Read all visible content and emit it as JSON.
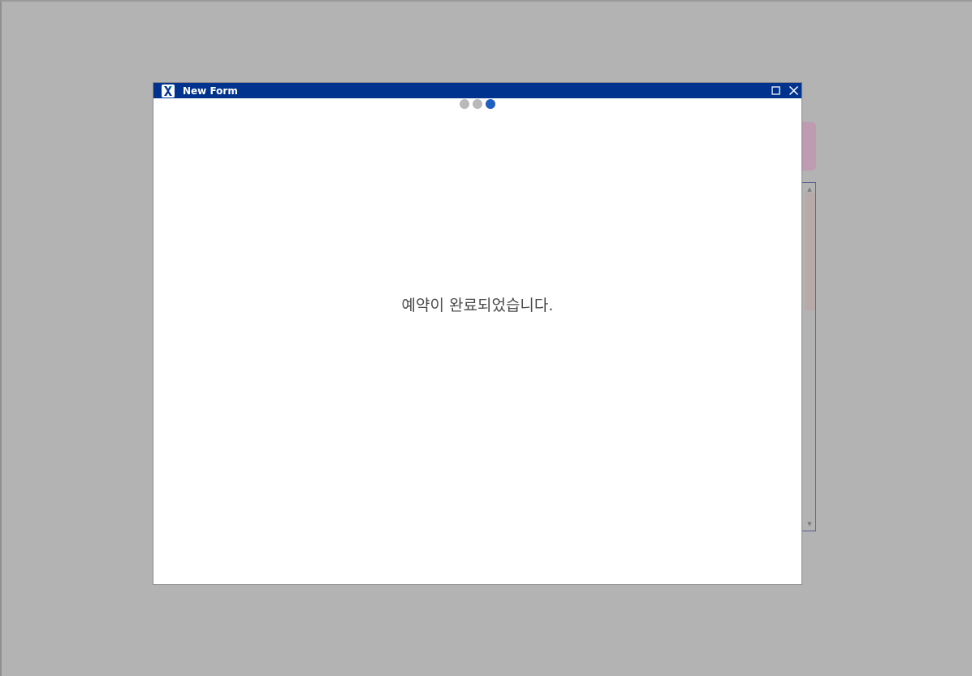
{
  "window": {
    "title": "New Form",
    "icon": "x-app-icon",
    "maximize_icon": "maximize-icon",
    "close_icon": "close-icon"
  },
  "loading_indicator": {
    "dots": 3,
    "active_dot": 3
  },
  "dialog": {
    "message": "예약이 완료되었습니다."
  },
  "colors": {
    "titlebar": "#00338d",
    "active_dot": "#1f5fbf",
    "inactive_dot": "#b9b9b9",
    "overlay": "#b3b3b3"
  }
}
